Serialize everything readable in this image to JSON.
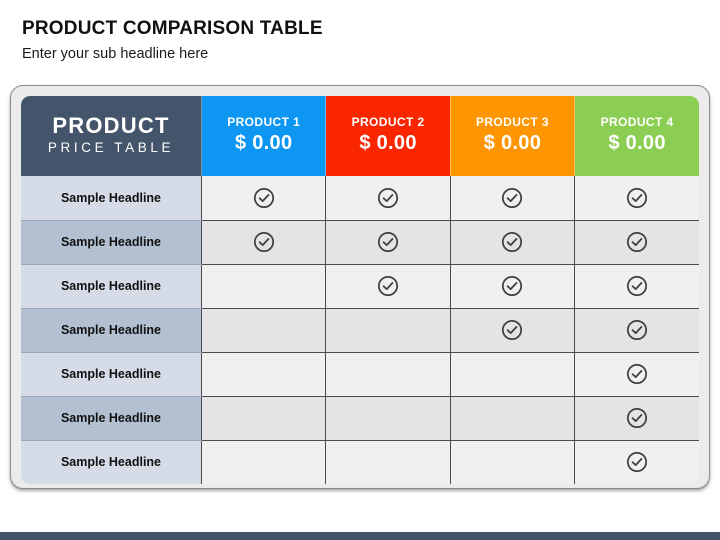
{
  "slide": {
    "title": "PRODUCT COMPARISON TABLE",
    "subtitle": "Enter your sub headline here"
  },
  "table": {
    "brand": {
      "line1": "PRODUCT",
      "line2": "PRICE TABLE",
      "color": "#44546b"
    },
    "columns": [
      {
        "name": "PRODUCT 1",
        "price": "$ 0.00",
        "color": "#0d96f2"
      },
      {
        "name": "PRODUCT 2",
        "price": "$ 0.00",
        "color": "#fa2600"
      },
      {
        "name": "PRODUCT 3",
        "price": "$ 0.00",
        "color": "#ff9500"
      },
      {
        "name": "PRODUCT 4",
        "price": "$ 0.00",
        "color": "#8cce54"
      }
    ],
    "rows": [
      {
        "label": "Sample Headline",
        "checks": [
          true,
          true,
          true,
          true
        ]
      },
      {
        "label": "Sample Headline",
        "checks": [
          true,
          true,
          true,
          true
        ]
      },
      {
        "label": "Sample Headline",
        "checks": [
          false,
          true,
          true,
          true
        ]
      },
      {
        "label": "Sample Headline",
        "checks": [
          false,
          false,
          true,
          true
        ]
      },
      {
        "label": "Sample Headline",
        "checks": [
          false,
          false,
          false,
          true
        ]
      },
      {
        "label": "Sample Headline",
        "checks": [
          false,
          false,
          false,
          true
        ]
      },
      {
        "label": "Sample Headline",
        "checks": [
          false,
          false,
          false,
          true
        ]
      }
    ],
    "check_icon": "check-circle-icon",
    "check_color": "#3f3f3f"
  },
  "theme": {
    "card_background": "#ebebeb",
    "bottom_bar_color": "#44546b",
    "label_odd": "#d5dce8",
    "label_even": "#b3c0d1",
    "cell_odd": "#f0f0f0",
    "cell_even": "#e4e4e4"
  }
}
